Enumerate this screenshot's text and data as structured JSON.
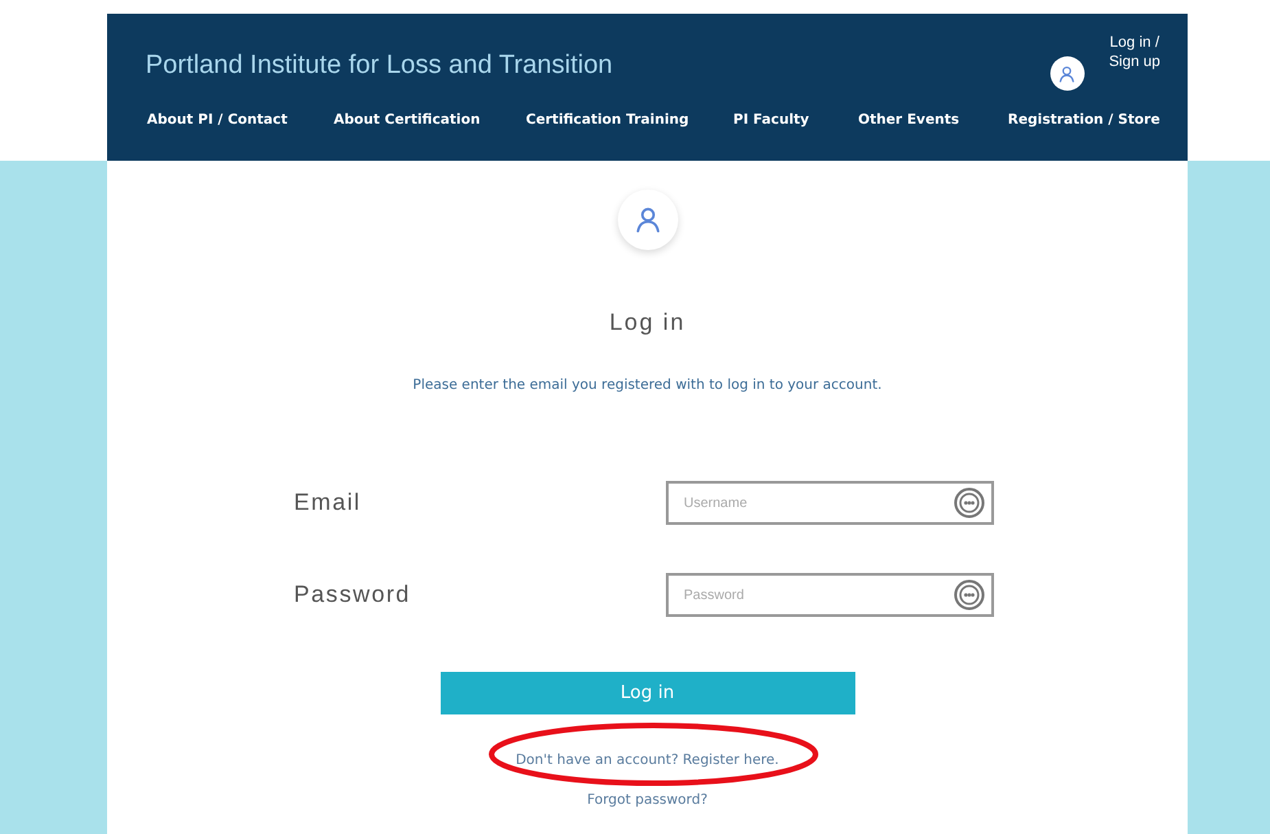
{
  "header": {
    "site_title": "Portland Institute for Loss and Transition",
    "account_link": "Log in /\nSign up"
  },
  "nav": [
    "About PI / Contact",
    "About Certification",
    "Certification Training",
    "PI Faculty",
    "Other Events",
    "Registration / Store"
  ],
  "login": {
    "title": "Log in",
    "subtitle": "Please enter the email you registered with to log in to your account.",
    "fields": [
      {
        "label": "Email",
        "placeholder": "Username"
      },
      {
        "label": "Password",
        "placeholder": "Password"
      }
    ],
    "button": "Log in",
    "register_link": {
      "text": "Don't have an account? Register here.",
      "circled": true
    },
    "forgot_link": "Forgot password?"
  }
}
